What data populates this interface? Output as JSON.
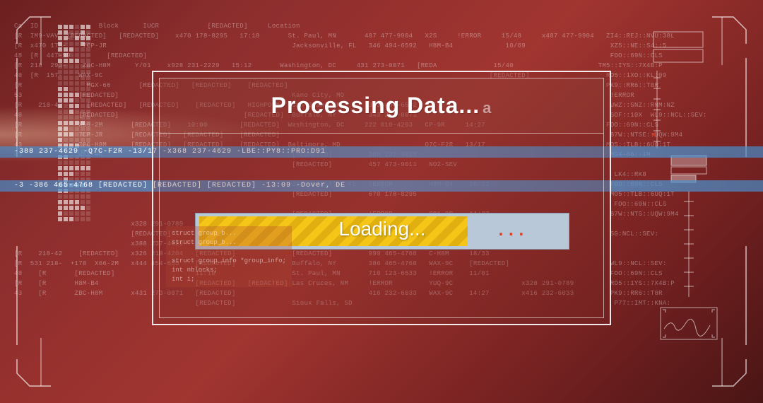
{
  "dialog": {
    "title": "Processing Data...",
    "title_glitch": "a",
    "progress_label": "Loading...",
    "progress_glitch": "...",
    "progress_percent": 72
  },
  "scan_lines": {
    "line1": "-3  -386 465-4768   [REDACTED]      [REDACTED]     [REDACTED]    -13:09        -Dover, DE",
    "line2": "                                                                       -388 237-4629   -Q7C-F2R       -13/17       -x368 237-4629   -LBE::PY8::PRO:D91"
  },
  "code_snippet": "struct group_b...\nstruct group_b...\n\nstruct group_info *group_info;\nint nblocks;\nint i;",
  "bg_columns": {
    "headers": "Ca  ID               Block      IUCR            [REDACTED]     Location",
    "rows": [
      "[R  IM9-VAV  [REDACTED]   [REDACTED]    x470 178-8295   17:18       St. Paul, MN       487 477-9904   X2S     !ERROR     15/48     x487 477-9904   ZI4::REJ::NVU:38L",
      "[R  x470 178-    7CP-JR                                              Jacksonville, FL   346 494-6592   H8M-B4             10/69                     XZ5::NE::S4::5",
      "48  [R  447-99         [REDACTED]                                                                                                                   FOO::69N::CLS",
      "[R  218  293-    ZBC-H8M      Y/01    x928 231-2229   15:12       Washington, DC     431 273-0071   [REDA              15/40                     TM5::IYS::7X4B:P",
      "48  [R  157-    WAX-9C                                                                                                [REDACTED]                   RO5::1XO::KL:09",
      "[R                MGX-66       [REDACTED]   [REDACTED]    [REDACTED]                                                                               PK9::RR6::T8R",
      "53              [REDACTED]                                           Kano City, MO                                                                  !ERROR",
      "[R    218-42      [REDACTED]   [REDACTED]    [REDACTED]   HIGHPOINT  San Juan, PR       343 494-6592                                                UWZ::SNZ::RNM:NZ",
      "48              [REDACTED]                               [REDACTED]  Buffalo, NY        343 273-0071                                                SOF::10X  WL9::NCL::SEV:",
      "[R              X66-2M       [REDACTED]    10:00        [REDACTED]  Washington, DC     222 810-4203   CP-9R     14:27                              FOO::69N::CLS",
      "[R              7CP-JR       [REDACTED]   [REDACTED]    [REDACTED]                                                                                  B7W::NTSE::UQW:9M4",
      "43              ZBC-H8M      [REDACTED]   [REDACTED]    [REDACTED]  Baltimore, MD                     Q7C-F2R   13/17                              MO5::TLB::6UQ:1T",
      "43              WAX-9C                                               [REDACTED]         388 237-4629                                                MGX-66::1M",
      "                                                                     [REDACTED]         457 473-9011   NO2-SEV                                      ",
      "                                                                                                                                                     LK4::RK8",
      "                                                                     Jacksonville, FL   !ERROR         H8M-B4    16/23                              FOO::69N::CLS",
      "                                                                     [REDACTED]         670 178-8295                                                MO5::TLB::6UQ:1T",
      "                                                                                                                                                     FOO::69N::CLS",
      "                                                                     [REDACTED]         !ERROR         CP1-9R    14:27                              B7W::NTS::UQW:9M4",
      "                             x328 291-0789   [REDACTED]              Washington, DC                                                                 ",
      "                             [REDACTED]      10:59                   WAX-9C,                                                                        SG:NCL::SEV:",
      "                             x388 237-4629   [REDACTED]              Baltimore, MD                                                                  ",
      "[R    218-42    [REDACTED]   x326 218-4204   [REDACTED]              [REDACTED]         999 465-4768   C-H8M     18/33                              ",
      "[R  531 218-  +178  X66-2M   x444 454-655    [REDACTED]              Buffalo, NY        386 465-4768   WAX-9C    [REDACTED]                         WL9::NCL::SEV:",
      "48    [R       [REDACTED]                    11:10                   St. Paul, MN       710 123-6533   !ERROR    11/01                              FOO::69N::CLS",
      "[R    [R       H8M-B4                        [REDACTED]   [REDACTED] Las Cruces, NM     !ERROR         YUQ-9C                 x328 291-0789         RO5::1YS::7X4B:P",
      "43    [R       ZBC-H8M       x431 273-0071   [REDACTED]                                 416 232-6033   WAX-9C    14:27        x416 232-6033         PK9::RR6::T8R",
      "                                             [REDACTED]              Sioux Falls, SD                                                                 P77::IMT::KNA:"
    ]
  },
  "bars": [
    [
      1,
      1,
      1,
      0,
      1,
      1
    ],
    [
      1,
      1,
      0,
      0,
      1,
      0
    ],
    [
      1,
      1,
      0,
      1,
      1,
      1
    ],
    [
      1,
      0,
      0,
      0,
      1,
      0
    ],
    [
      1,
      1,
      1,
      0,
      0,
      0
    ],
    [
      0,
      1,
      0,
      0,
      0,
      0
    ],
    [
      1,
      1,
      1,
      1,
      0,
      0
    ],
    [
      0,
      0,
      0,
      0,
      0,
      0
    ],
    [
      0,
      0,
      0,
      0,
      0,
      0
    ],
    [
      0,
      0,
      0,
      0,
      0,
      0
    ],
    [
      0,
      0,
      0,
      0,
      0,
      0
    ],
    [
      1,
      1,
      0,
      0,
      0,
      0
    ],
    [
      1,
      1,
      1,
      1,
      0,
      0
    ],
    [
      1,
      1,
      1,
      0,
      0,
      0
    ],
    [
      1,
      0,
      1,
      1,
      0,
      0
    ],
    [
      0,
      0,
      1,
      0,
      0,
      0
    ],
    [
      0,
      0,
      0,
      0,
      0,
      0
    ],
    [
      1,
      1,
      1,
      1,
      1,
      0
    ],
    [
      1,
      1,
      0,
      0,
      0,
      0
    ],
    [
      1,
      1,
      1,
      0,
      0,
      0
    ],
    [
      1,
      0,
      0,
      0,
      0,
      0
    ],
    [
      1,
      1,
      1,
      1,
      0,
      0
    ],
    [
      0,
      0,
      0,
      0,
      0,
      0
    ],
    [
      1,
      1,
      0,
      0,
      0,
      0
    ],
    [
      0,
      0,
      0,
      0,
      0,
      0
    ],
    [
      1,
      1,
      1,
      1,
      1,
      1
    ],
    [
      1,
      1,
      1,
      0,
      0,
      0
    ],
    [
      0,
      1,
      0,
      0,
      0,
      0
    ],
    [
      1,
      1,
      1,
      1,
      1,
      0
    ],
    [
      1,
      1,
      0,
      0,
      0,
      0
    ],
    [
      0,
      0,
      0,
      0,
      0,
      0
    ],
    [
      1,
      1,
      1,
      1,
      0,
      0
    ],
    [
      1,
      1,
      1,
      1,
      1,
      0
    ],
    [
      1,
      0,
      0,
      0,
      0,
      0
    ],
    [
      1,
      1,
      1,
      0,
      0,
      0
    ]
  ]
}
